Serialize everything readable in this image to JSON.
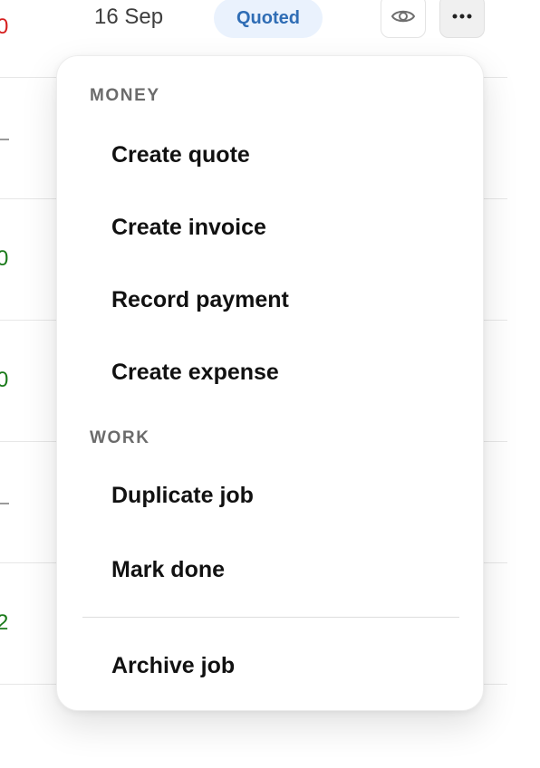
{
  "table": {
    "rows": [
      {
        "amount_fragment": "0",
        "amount_color": "#d61f1f",
        "date": "16 Sep",
        "status": "Quoted",
        "status_bg": "#eaf2fd",
        "status_color": "#2f6db5"
      },
      {
        "amount_fragment": "",
        "amount_display": "dash"
      },
      {
        "amount_fragment": "0",
        "amount_color": "#1a7a1a"
      },
      {
        "amount_fragment": "0",
        "amount_color": "#1a7a1a"
      },
      {
        "amount_fragment": "",
        "amount_display": "dash"
      },
      {
        "amount_fragment": "2",
        "amount_color": "#1a7a1a"
      }
    ]
  },
  "actions": {
    "view_icon": "eye-icon",
    "more_icon": "more-horizontal-icon"
  },
  "menu": {
    "sections": [
      {
        "heading": "MONEY",
        "items": [
          {
            "label": "Create quote"
          },
          {
            "label": "Create invoice"
          },
          {
            "label": "Record payment"
          },
          {
            "label": "Create expense"
          }
        ]
      },
      {
        "heading": "WORK",
        "items": [
          {
            "label": "Duplicate job"
          },
          {
            "label": "Mark done"
          }
        ]
      }
    ],
    "archive": {
      "label": "Archive job"
    }
  },
  "colors": {
    "negative": "#d61f1f",
    "positive": "#1a7a1a",
    "badge_text": "#2f6db5",
    "badge_bg": "#eaf2fd"
  }
}
